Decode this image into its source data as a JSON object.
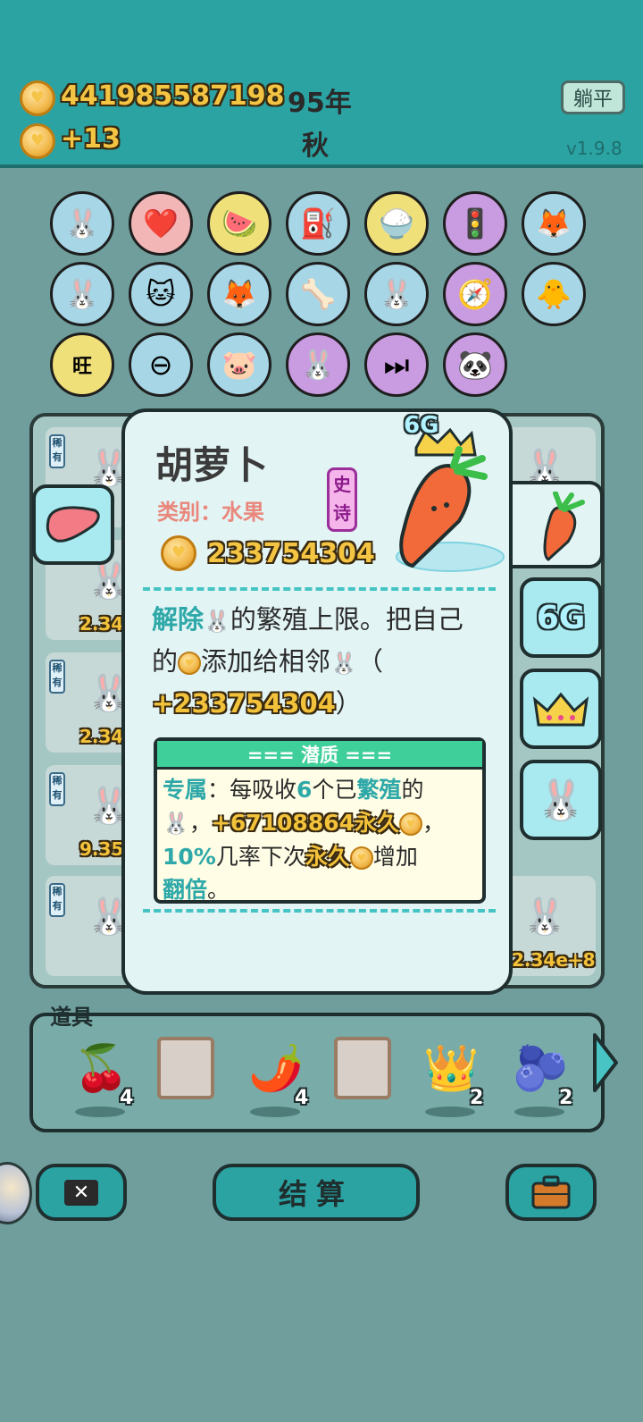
{
  "header": {
    "coins": "441985587198",
    "income": "+13",
    "year": "95年",
    "season": "秋",
    "lie_flat_label": "躺平",
    "version": "v1.9.8"
  },
  "upgrades": [
    {
      "name": "twin-bunnies",
      "glyph": "🐰"
    },
    {
      "name": "heart-cauldron",
      "glyph": "❤️"
    },
    {
      "name": "fruit-bowl",
      "glyph": "🍉"
    },
    {
      "name": "pump",
      "glyph": "⛽"
    },
    {
      "name": "rice-bowl",
      "glyph": "🍚"
    },
    {
      "name": "traffic-light",
      "glyph": "🚦"
    },
    {
      "name": "fox-pair",
      "glyph": "🦊"
    },
    {
      "name": "bunny",
      "glyph": "🐰"
    },
    {
      "name": "cool-cat",
      "glyph": "🐱"
    },
    {
      "name": "fox-pair",
      "glyph": "🦊"
    },
    {
      "name": "dog-bowl",
      "glyph": "🦴"
    },
    {
      "name": "bunny",
      "glyph": "🐰"
    },
    {
      "name": "compass",
      "glyph": "🧭"
    },
    {
      "name": "chick",
      "glyph": "🐥"
    },
    {
      "name": "wang-tiles",
      "glyph": "旺"
    },
    {
      "name": "minus-sign",
      "glyph": "⊖"
    },
    {
      "name": "piggy-bank",
      "glyph": "🐷"
    },
    {
      "name": "twin-bunnies",
      "glyph": "🐰"
    },
    {
      "name": "skip-sign",
      "glyph": "⏭"
    },
    {
      "name": "panda",
      "glyph": "🐼"
    }
  ],
  "board": {
    "rare_label": "稀有",
    "bunny_glyph": "🐰",
    "values": [
      "2.34e",
      "2.34e",
      "9.35e",
      "2.34e+8"
    ]
  },
  "card": {
    "title": "胡萝卜",
    "category": "类别：水果",
    "rarity": "史诗",
    "value": "233754304",
    "badge": "6G",
    "description": {
      "p1": "解除",
      "p2": "的繁殖上限。把自己的",
      "p3": "添加给相邻",
      "p4": "（",
      "p5": "+233754304",
      "p6": "）"
    },
    "potential": {
      "title": "=== 潜质 ===",
      "exclusive": "专属",
      "t1": "：每吸收",
      "n6": "6",
      "t2": "个已",
      "breed": "繁殖",
      "t3": "的",
      "t4": "，",
      "perm_add": "+67108864永久",
      "t5": "，",
      "pct": "10%",
      "t6": "几率下次",
      "perm": "永久",
      "t7": "增加",
      "double": "翻倍",
      "t8": "。"
    }
  },
  "side_tabs": {
    "six_g": "6G"
  },
  "items": {
    "label": "道具",
    "list": [
      {
        "name": "lychee",
        "glyph": "🍒",
        "count": "4"
      },
      {
        "name": "empty-slot",
        "glyph": "",
        "count": ""
      },
      {
        "name": "goji-berry",
        "glyph": "🌶️",
        "count": "4"
      },
      {
        "name": "empty-slot",
        "glyph": "",
        "count": ""
      },
      {
        "name": "crown",
        "glyph": "👑",
        "count": "2"
      },
      {
        "name": "blueberry",
        "glyph": "🫐",
        "count": "2"
      }
    ]
  },
  "bottom": {
    "settle_label": "结算",
    "close_label": "✕"
  }
}
